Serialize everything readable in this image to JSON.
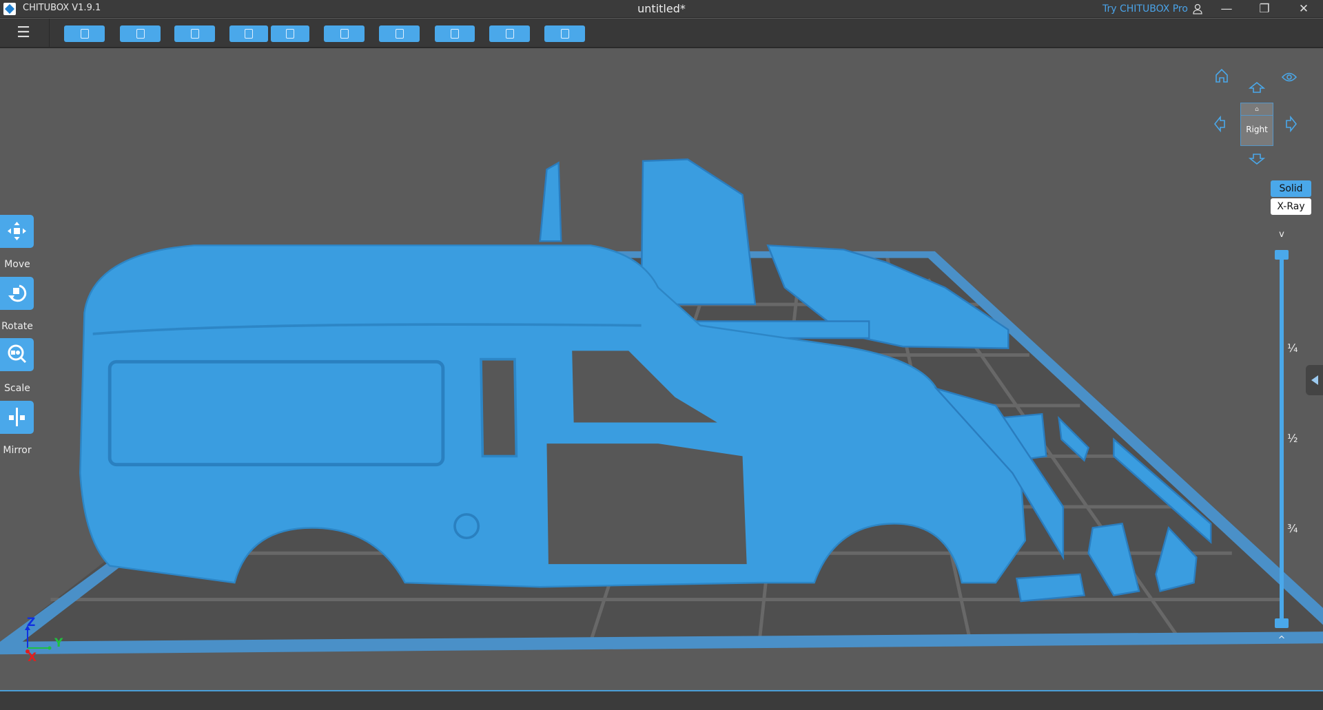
{
  "window": {
    "app_name": "CHITUBOX V1.9.1",
    "document_title": "untitled*",
    "try_pro": "Try CHITUBOX Pro",
    "minimize": "—",
    "restore": "❐",
    "close": "✕"
  },
  "toolbar": {
    "menu_icon": "☰",
    "buttons": [
      "open-file",
      "save",
      "auto-layout",
      "undo",
      "redo",
      "slice-settings",
      "hollow",
      "support",
      "dig-hole",
      "batch-operation"
    ]
  },
  "left_tools": [
    {
      "label": "Move"
    },
    {
      "label": "Rotate"
    },
    {
      "label": "Scale"
    },
    {
      "label": "Mirror"
    }
  ],
  "view_cube": {
    "face": "Right",
    "top_glyph": "⌂"
  },
  "render_modes": {
    "solid": "Solid",
    "xray": "X-Ray",
    "active": "Solid"
  },
  "layer_slider": {
    "ticks": [
      "¼",
      "½",
      "¾"
    ],
    "top_value": 1.0,
    "bottom_value": 0.0,
    "chevron_up": "^",
    "chevron_down": "v"
  },
  "axes": {
    "z": "Z",
    "y": "Y",
    "x": "X"
  },
  "colors": {
    "accent": "#4aa8ea",
    "model": "#3a9de0",
    "platform": "#4a90c8"
  }
}
